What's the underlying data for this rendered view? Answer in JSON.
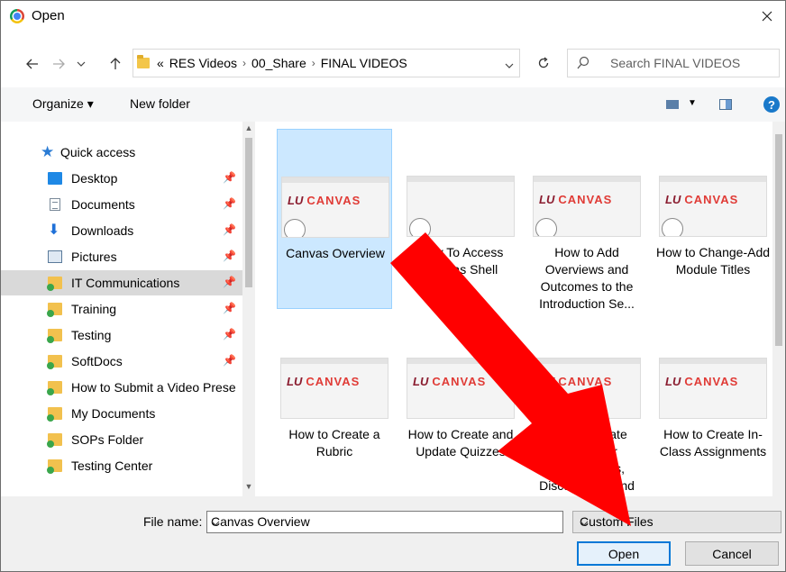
{
  "window": {
    "title": "Open"
  },
  "nav": {
    "breadcrumb_prefix": "«",
    "crumbs": [
      "RES Videos",
      "00_Share",
      "FINAL VIDEOS"
    ],
    "search_placeholder": "Search FINAL VIDEOS"
  },
  "toolbar": {
    "organize_label": "Organize ▾",
    "new_folder_label": "New folder",
    "help_glyph": "?"
  },
  "sidebar": {
    "items": [
      {
        "label": "Quick access",
        "icon": "star-icon",
        "pinned": false
      },
      {
        "label": "Desktop",
        "icon": "desktop-icon",
        "pinned": true
      },
      {
        "label": "Documents",
        "icon": "documents-icon",
        "pinned": true
      },
      {
        "label": "Downloads",
        "icon": "downloads-icon",
        "pinned": true
      },
      {
        "label": "Pictures",
        "icon": "pictures-icon",
        "pinned": true
      },
      {
        "label": "IT Communications",
        "icon": "shared-folder-icon",
        "pinned": true,
        "selected": true
      },
      {
        "label": "Training",
        "icon": "shared-folder-icon",
        "pinned": true
      },
      {
        "label": "Testing",
        "icon": "shared-folder-icon",
        "pinned": true
      },
      {
        "label": "SoftDocs",
        "icon": "shared-folder-icon",
        "pinned": true
      },
      {
        "label": "How to Submit a Video Prese",
        "icon": "shared-folder-icon",
        "pinned": false
      },
      {
        "label": "My Documents",
        "icon": "shared-folder-icon",
        "pinned": false
      },
      {
        "label": "SOPs Folder",
        "icon": "shared-folder-icon",
        "pinned": false
      },
      {
        "label": "Testing Center",
        "icon": "shared-folder-icon",
        "pinned": false
      }
    ]
  },
  "files": [
    {
      "label": "Canvas Overview",
      "selected": true,
      "thumb": "google-canvas"
    },
    {
      "label": "How To Access Canvas Shell",
      "thumb": "google-blank"
    },
    {
      "label": "How to Add Overviews and Outcomes to the Introduction Se...",
      "thumb": "lu-canvas"
    },
    {
      "label": "How to Change-Add Module Titles",
      "thumb": "lu-canvas"
    },
    {
      "label": "How to Create a Rubric",
      "thumb": "lu-canvas"
    },
    {
      "label": "How to Create and Update Quizzes",
      "thumb": "lu-canvas"
    },
    {
      "label": "How to Create Rubrics for Assignments, Discussions, and Qui...",
      "thumb": "lu-canvas"
    },
    {
      "label": "How to Create In-Class Assignments",
      "thumb": "lu-canvas"
    }
  ],
  "thumb_text": {
    "lu": "LU",
    "canvas": "CANVAS"
  },
  "bottom": {
    "file_name_label": "File name:",
    "file_name_value": "Canvas Overview",
    "file_type_value": "Custom Files",
    "open_label": "Open",
    "cancel_label": "Cancel"
  },
  "annotation": {
    "arrow_color": "#ff0000",
    "points_to": "Open"
  },
  "colors": {
    "selection_bg": "#cce8ff",
    "accent": "#0078d7"
  }
}
